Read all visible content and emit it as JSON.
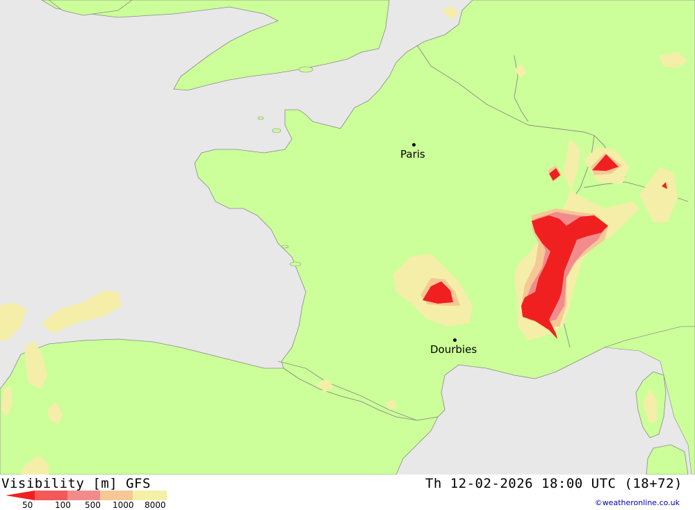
{
  "header": {
    "title": "Visibility [m] GFS",
    "datetime": "Th 12-02-2026 18:00 UTC (18+72)"
  },
  "legend": {
    "ticks": [
      "50",
      "100",
      "500",
      "1000",
      "8000"
    ],
    "colors": [
      "#f02020",
      "#f25a5a",
      "#f28c8c",
      "#f5c896",
      "#f5f0a8"
    ]
  },
  "cities": [
    {
      "name": "Paris"
    },
    {
      "name": "Dourbies"
    }
  ],
  "credit": "©weatheronline.co.uk",
  "colors": {
    "sea": "#e8e8e8",
    "land": "#ccff99",
    "border": "#888888",
    "low_visibility_red": "#f02020",
    "moderate_visibility": "#f5eea8"
  }
}
